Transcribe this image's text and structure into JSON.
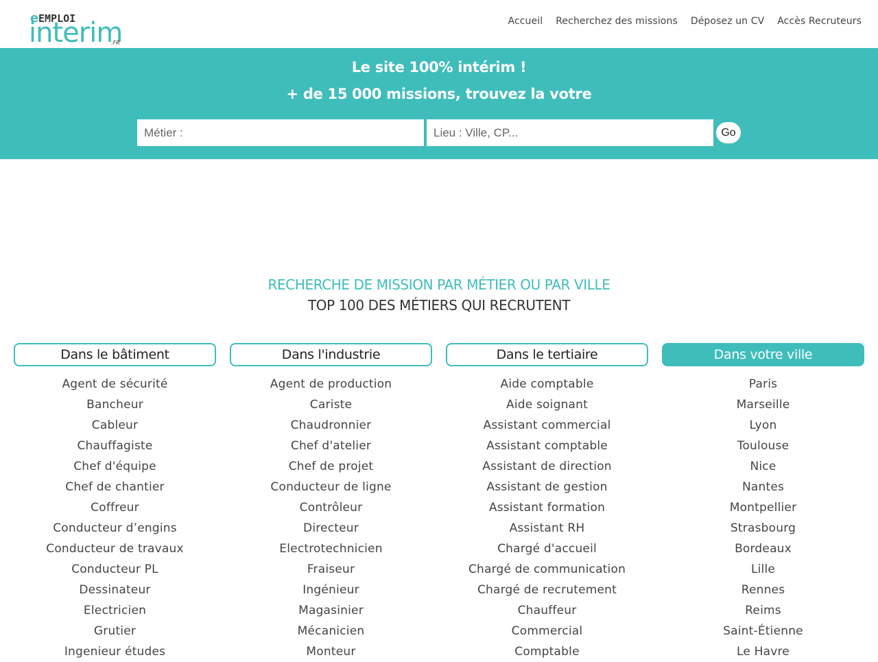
{
  "brand": {
    "logo_top": "EMPLOI",
    "logo_main": "interim",
    "logo_suffix": ".FR",
    "accent_color": "#3fbdbb"
  },
  "nav": [
    "Accueil",
    "Recherchez des missions",
    "Déposez un CV",
    "Accès Recruteurs"
  ],
  "hero": {
    "line1": "Le site 100% intérim !",
    "line2": "+ de 15 000 missions, trouvez la votre",
    "metier_placeholder": "Métier :",
    "lieu_placeholder": "Lieu : Ville, CP...",
    "go_label": "Go"
  },
  "section": {
    "title": "RECHERCHE DE MISSION PAR MÉTIER OU PAR VILLE",
    "subtitle": "TOP 100 DES MÉTIERS QUI RECRUTENT"
  },
  "columns": [
    {
      "heading": "Dans le bâtiment",
      "items": [
        "Agent de sécurité",
        "Bancheur",
        "Cableur",
        "Chauffagiste",
        "Chef d'équipe",
        "Chef de chantier",
        "Coffreur",
        "Conducteur d’engins",
        "Conducteur de travaux",
        "Conducteur PL",
        "Dessinateur",
        "Electricien",
        "Grutier",
        "Ingenieur études"
      ]
    },
    {
      "heading": "Dans l'industrie",
      "items": [
        "Agent de production",
        "Cariste",
        "Chaudronnier",
        "Chef d'atelier",
        "Chef de projet",
        "Conducteur de ligne",
        "Contrôleur",
        "Directeur",
        "Electrotechnicien",
        "Fraiseur",
        "Ingénieur",
        "Magasinier",
        "Mécanicien",
        "Monteur"
      ]
    },
    {
      "heading": "Dans le tertiaire",
      "items": [
        "Aide comptable",
        "Aide soignant",
        "Assistant commercial",
        "Assistant comptable",
        "Assistant de direction",
        "Assistant de gestion",
        "Assistant formation",
        "Assistant RH",
        "Chargé d'accueil",
        "Chargé de communication",
        "Chargé de recrutement",
        "Chauffeur",
        "Commercial",
        "Comptable"
      ]
    },
    {
      "heading": "Dans votre ville",
      "items": [
        "Paris",
        "Marseille",
        "Lyon",
        "Toulouse",
        "Nice",
        "Nantes",
        "Montpellier",
        "Strasbourg",
        "Bordeaux",
        "Lille",
        "Rennes",
        "Reims",
        "Saint-Étienne",
        "Le Havre"
      ]
    }
  ]
}
